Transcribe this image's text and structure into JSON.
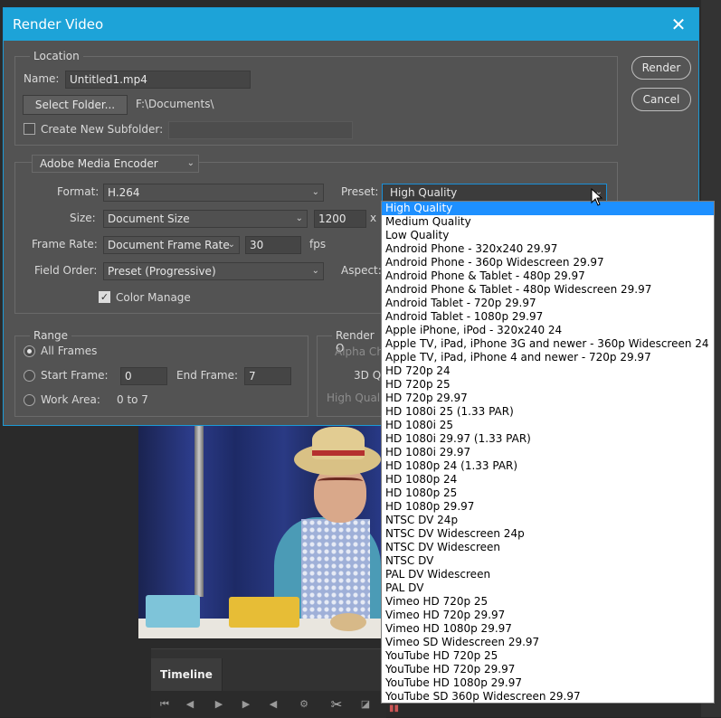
{
  "dialog": {
    "title": "Render Video",
    "close_label": "✕",
    "render_button": "Render",
    "cancel_button": "Cancel"
  },
  "location": {
    "legend": "Location",
    "name_label": "Name:",
    "name_value": "Untitled1.mp4",
    "select_folder_button": "Select Folder...",
    "folder_path": "F:\\Documents\\",
    "create_subfolder_label": "Create New Subfolder:",
    "create_subfolder_checked": false,
    "subfolder_value": ""
  },
  "encoder": {
    "selected": "Adobe Media Encoder",
    "format_label": "Format:",
    "format_value": "H.264",
    "preset_label": "Preset:",
    "preset_value": "High Quality",
    "size_label": "Size:",
    "size_value": "Document Size",
    "width_value": "1200",
    "size_separator": "x",
    "frame_rate_label": "Frame Rate:",
    "frame_rate_value": "Document Frame Rate",
    "fps_value": "30",
    "fps_unit": "fps",
    "field_order_label": "Field Order:",
    "field_order_value": "Preset (Progressive)",
    "aspect_label": "Aspect:",
    "color_manage_label": "Color Manage",
    "color_manage_checked": true
  },
  "range": {
    "legend": "Range",
    "all_frames_label": "All Frames",
    "start_frame_label": "Start Frame:",
    "start_frame_value": "0",
    "end_frame_label": "End Frame:",
    "end_frame_value": "7",
    "work_area_label": "Work Area:",
    "work_area_value": "0 to 7",
    "selected": "All Frames"
  },
  "render_options": {
    "legend": "Render O",
    "alpha_label": "Alpha Ch",
    "quality_3d_label": "3D Q",
    "high_quality_label": "High Qualit"
  },
  "preset_options": [
    "High Quality",
    "Medium Quality",
    "Low Quality",
    "Android Phone - 320x240 29.97",
    "Android Phone - 360p Widescreen 29.97",
    "Android Phone & Tablet - 480p 29.97",
    "Android Phone & Tablet - 480p Widescreen 29.97",
    "Android Tablet - 720p 29.97",
    "Android Tablet - 1080p 29.97",
    "Apple iPhone, iPod - 320x240 24",
    "Apple TV, iPad, iPhone 3G and newer - 360p Widescreen 24",
    "Apple TV, iPad, iPhone 4 and newer - 720p 29.97",
    "HD 720p 24",
    "HD 720p 25",
    "HD 720p 29.97",
    "HD 1080i 25 (1.33 PAR)",
    "HD 1080i 25",
    "HD 1080i 29.97 (1.33 PAR)",
    "HD 1080i 29.97",
    "HD 1080p 24 (1.33 PAR)",
    "HD 1080p 24",
    "HD 1080p 25",
    "HD 1080p 29.97",
    "NTSC DV 24p",
    "NTSC DV Widescreen 24p",
    "NTSC DV Widescreen",
    "NTSC DV",
    "PAL DV Widescreen",
    "PAL DV",
    "Vimeo HD 720p 25",
    "Vimeo HD 720p 29.97",
    "Vimeo HD 1080p 29.97",
    "Vimeo SD Widescreen 29.97",
    "YouTube HD 720p 25",
    "YouTube HD 720p 29.97",
    "YouTube HD 1080p 29.97",
    "YouTube SD 360p Widescreen 29.97"
  ],
  "preset_selected_index": 0,
  "timeline": {
    "tab_label": "Timeline"
  },
  "colors": {
    "titlebar": "#1da3d8",
    "dialog_bg": "#535353",
    "selection": "#1e90ff"
  }
}
